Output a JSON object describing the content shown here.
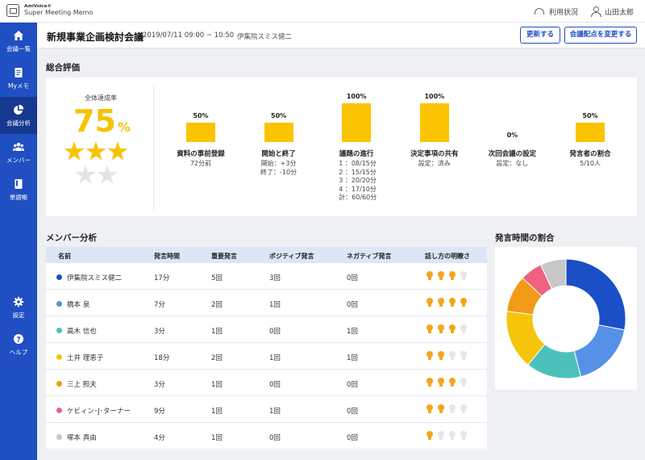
{
  "app": {
    "brand": "AmiVoice®",
    "product": "Super Meeting Memo"
  },
  "topbar": {
    "usage_label": "利用状況",
    "user_name": "山田太郎"
  },
  "sidebar": {
    "items": [
      {
        "label": "会議一覧",
        "icon": "home-icon",
        "active": false
      },
      {
        "label": "Myメモ",
        "icon": "memo-icon",
        "active": false
      },
      {
        "label": "会議分析",
        "icon": "pie-chart-icon",
        "active": true
      },
      {
        "label": "メンバー",
        "icon": "members-icon",
        "active": false
      },
      {
        "label": "単語帳",
        "icon": "book-icon",
        "active": false
      },
      {
        "label": "設定",
        "icon": "gear-icon",
        "active": false
      },
      {
        "label": "ヘルプ",
        "icon": "help-icon",
        "active": false
      }
    ]
  },
  "header": {
    "title": "新規事業企画検討会議",
    "datetime": "2019/07/11  09:00 ~ 10:50",
    "person": "伊集院スミス健二",
    "update_button": "更新する",
    "change_points_button": "会議配点を変更する"
  },
  "overall": {
    "section_title": "総合評価",
    "rate_label": "全体達成率",
    "rate_value": "75",
    "rate_unit": "%",
    "stars_filled": 3,
    "stars_total": 5,
    "metrics": [
      {
        "percent_label": "50%",
        "percent": 50,
        "label": "資料の事前登録",
        "detail": "72分前",
        "align": "center"
      },
      {
        "percent_label": "50%",
        "percent": 50,
        "label": "開始と終了",
        "detail": "開始：+3分\n終了：-10分",
        "align": "center"
      },
      {
        "percent_label": "100%",
        "percent": 100,
        "label": "議題の進行",
        "detail": "1 ：08/15分\n2 ：15/15分\n3 ：20/20分\n4 ：17/10分\n計：60/60分",
        "align": "left"
      },
      {
        "percent_label": "100%",
        "percent": 100,
        "label": "決定事項の共有",
        "detail": "設定：済み",
        "align": "center"
      },
      {
        "percent_label": "0%",
        "percent": 0,
        "label": "次回会議の設定",
        "detail": "設定：なし",
        "align": "center"
      },
      {
        "percent_label": "50%",
        "percent": 50,
        "label": "発言者の割合",
        "detail": "5/10人",
        "align": "center"
      }
    ]
  },
  "members": {
    "section_title": "メンバー分析",
    "headers": [
      "名前",
      "発言時間",
      "重要発言",
      "ポジティブ発言",
      "ネガティブ発言",
      "話し方の明瞭さ"
    ],
    "rows": [
      {
        "name": "伊集院スミス健二",
        "color": "#1a4fc7",
        "time": "17分",
        "important": "5回",
        "positive": "3回",
        "negative": "0回",
        "clarity": 3
      },
      {
        "name": "橋本 泉",
        "color": "#5591e6",
        "time": "7分",
        "important": "2回",
        "positive": "1回",
        "negative": "0回",
        "clarity": 4
      },
      {
        "name": "高木 信也",
        "color": "#4cc1bb",
        "time": "3分",
        "important": "1回",
        "positive": "0回",
        "negative": "1回",
        "clarity": 3
      },
      {
        "name": "土井 理恵子",
        "color": "#f6c40a",
        "time": "18分",
        "important": "2回",
        "positive": "1回",
        "negative": "1回",
        "clarity": 2
      },
      {
        "name": "三上 照夫",
        "color": "#f29a16",
        "time": "3分",
        "important": "1回",
        "positive": "0回",
        "negative": "0回",
        "clarity": 3
      },
      {
        "name": "ケビィン･J･ターナー",
        "color": "#ef6380",
        "time": "9分",
        "important": "1回",
        "positive": "1回",
        "negative": "0回",
        "clarity": 2
      },
      {
        "name": "塚本 真由",
        "color": "#c8c8c8",
        "time": "4分",
        "important": "1回",
        "positive": "0回",
        "negative": "0回",
        "clarity": 1
      }
    ]
  },
  "speaking_share": {
    "section_title": "発言時間の割合"
  },
  "chart_data": {
    "type": "pie",
    "title": "発言時間の割合",
    "categories": [
      "伊集院スミス健二",
      "橋本 泉",
      "高木 信也",
      "土井 理恵子",
      "三上 照夫",
      "ケビィン･J･ターナー",
      "塚本 真由"
    ],
    "values": [
      28,
      18,
      15,
      16,
      10,
      6,
      7
    ],
    "colors": [
      "#1a4fc7",
      "#5591e6",
      "#4cc1bb",
      "#f6c40a",
      "#f29a16",
      "#ef6380",
      "#c8c8c8"
    ]
  }
}
